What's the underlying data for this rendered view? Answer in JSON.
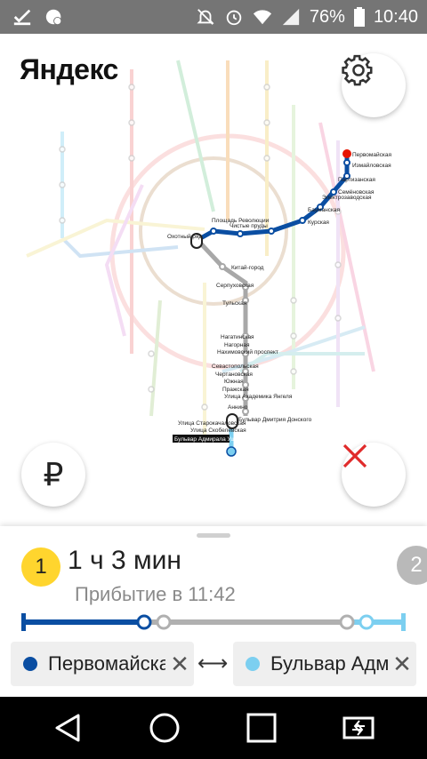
{
  "status_bar": {
    "battery": "76%",
    "time": "10:40",
    "icons": [
      "check-icon",
      "notification-icon",
      "mute-icon",
      "alarm-icon",
      "wifi-icon",
      "signal-icon",
      "battery-icon"
    ]
  },
  "map": {
    "logo": "Яндекс",
    "settings_icon": "gear-icon",
    "fare_symbol": "₽",
    "close_icon": "close-icon",
    "route_labels": [
      "Первомайская",
      "Измайловская",
      "Партизанская",
      "Семёновская",
      "Электрозаводская",
      "Бауманская",
      "Курская",
      "Чистые пруды",
      "Охотный ряд",
      "Площадь Революции",
      "Китай-город",
      "Тульская",
      "Нагатинская",
      "Нагорная",
      "Нахимовский проспект",
      "Севастопольская",
      "Чертановская",
      "Южная",
      "Пражская",
      "Улица Академика Янгеля",
      "Аннино",
      "Бульвар Дмитрия Донского",
      "Улица Старокачаловская",
      "Улица Скобелевская",
      "Бульвар Адмирала Ушакова",
      "Серпуховская"
    ]
  },
  "sheet": {
    "route_number": "1",
    "next_route_number": "2",
    "duration": "1 ч 3 мин",
    "arrival_label": "Прибытие в 11:42",
    "progress_segments": [
      {
        "color": "#0a4ea2",
        "fraction": 0.33
      },
      {
        "color": "#a8a8a8",
        "fraction": 0.52
      },
      {
        "color": "#7ccff0",
        "fraction": 0.15
      }
    ],
    "from_station": "Первомайская",
    "from_color": "#0a4ea2",
    "to_station": "Бульвар Адмирала Ушакова",
    "to_color": "#7ccff0",
    "clear_symbol": "✕",
    "swap_symbol": "⟷"
  },
  "nav_bar": {
    "icons": [
      "back-icon",
      "home-icon",
      "recents-icon",
      "screen-share-icon"
    ]
  }
}
